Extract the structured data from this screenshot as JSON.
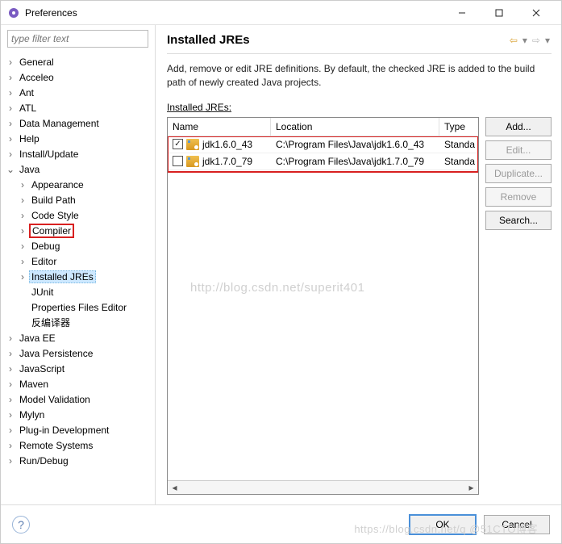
{
  "window": {
    "title": "Preferences"
  },
  "filter": {
    "placeholder": "type filter text"
  },
  "tree": {
    "items": [
      "General",
      "Acceleo",
      "Ant",
      "ATL",
      "Data Management",
      "Help",
      "Install/Update"
    ],
    "java": {
      "label": "Java",
      "children": [
        "Appearance",
        "Build Path",
        "Code Style",
        "Compiler",
        "Debug",
        "Editor",
        "Installed JREs",
        "JUnit",
        "Properties Files Editor",
        "反编译器"
      ]
    },
    "after": [
      "Java EE",
      "Java Persistence",
      "JavaScript",
      "Maven",
      "Model Validation",
      "Mylyn",
      "Plug-in Development",
      "Remote Systems",
      "Run/Debug"
    ]
  },
  "page": {
    "title": "Installed JREs",
    "description": "Add, remove or edit JRE definitions. By default, the checked JRE is added to the build path of newly created Java projects.",
    "list_label_prefix": "Installed ",
    "list_label_underlined": "J",
    "list_label_suffix": "REs:"
  },
  "table": {
    "columns": {
      "name": "Name",
      "location": "Location",
      "type": "Type"
    },
    "rows": [
      {
        "checked": true,
        "name": "jdk1.6.0_43",
        "location": "C:\\Program Files\\Java\\jdk1.6.0_43",
        "type": "Standa"
      },
      {
        "checked": false,
        "name": "jdk1.7.0_79",
        "location": "C:\\Program Files\\Java\\jdk1.7.0_79",
        "type": "Standa"
      }
    ]
  },
  "buttons": {
    "add": "Add...",
    "edit": "Edit...",
    "duplicate": "Duplicate...",
    "remove": "Remove",
    "search": "Search..."
  },
  "footer": {
    "ok": "OK",
    "cancel": "Cancel"
  },
  "watermarks": {
    "w1": "http://blog.csdn.net/superit401",
    "w2": "https://blog.csdn.net/q @51CTO博客"
  }
}
